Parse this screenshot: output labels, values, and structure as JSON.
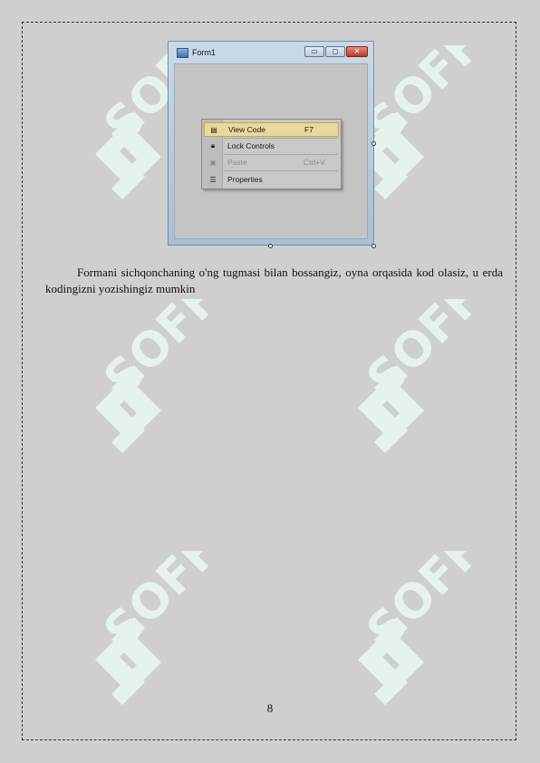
{
  "page": {
    "number": "8"
  },
  "watermark": {
    "text": "SOFF",
    "color": "#e6f3ec"
  },
  "form_window": {
    "title": "Form1",
    "minimize_glyph": "▭",
    "maximize_glyph": "◻",
    "close_glyph": "✕"
  },
  "context_menu": {
    "items": [
      {
        "label": "View Code",
        "shortcut": "F7",
        "icon": "view-code-icon",
        "state": "highlighted"
      },
      {
        "label": "Lock Controls",
        "shortcut": "",
        "icon": "lock-icon",
        "state": "normal"
      },
      {
        "label": "Paste",
        "shortcut": "Ctrl+V",
        "icon": "paste-icon",
        "state": "disabled"
      },
      {
        "label": "Properties",
        "shortcut": "",
        "icon": "properties-icon",
        "state": "normal"
      }
    ]
  },
  "body": {
    "paragraph": "Formani sichqonchaning o'ng tugmasi bilan bossangiz, oyna orqasida kod olasiz, u erda kodingizni yozishingiz mumkin"
  }
}
